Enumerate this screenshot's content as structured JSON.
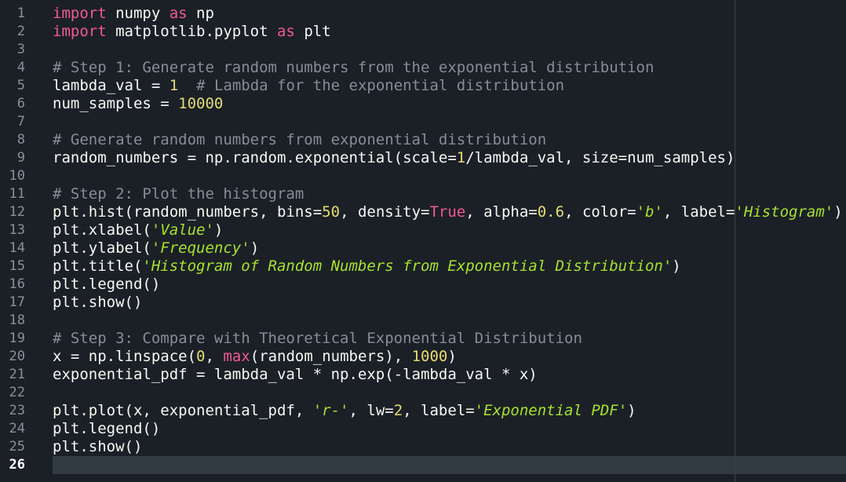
{
  "editor": {
    "active_line": 26,
    "colors": {
      "background": "#1b2027",
      "keyword": "#f25a8f",
      "comment": "#858d96",
      "number": "#e6db74",
      "string": "#a6e22e",
      "text": "#f8f8f2"
    },
    "lines": [
      {
        "n": "1",
        "tokens": [
          {
            "t": "import",
            "c": "kw"
          },
          {
            "t": " numpy "
          },
          {
            "t": "as",
            "c": "kw"
          },
          {
            "t": " np"
          }
        ]
      },
      {
        "n": "2",
        "tokens": [
          {
            "t": "import",
            "c": "kw"
          },
          {
            "t": " matplotlib.pyplot "
          },
          {
            "t": "as",
            "c": "kw"
          },
          {
            "t": " plt"
          }
        ]
      },
      {
        "n": "3",
        "tokens": []
      },
      {
        "n": "4",
        "tokens": [
          {
            "t": "# Step 1: Generate random numbers from the exponential distribution",
            "c": "cm"
          }
        ]
      },
      {
        "n": "5",
        "tokens": [
          {
            "t": "lambda_val = "
          },
          {
            "t": "1",
            "c": "num"
          },
          {
            "t": "  "
          },
          {
            "t": "# Lambda for the exponential distribution",
            "c": "cm"
          }
        ]
      },
      {
        "n": "6",
        "tokens": [
          {
            "t": "num_samples = "
          },
          {
            "t": "10000",
            "c": "num"
          }
        ]
      },
      {
        "n": "7",
        "tokens": []
      },
      {
        "n": "8",
        "tokens": [
          {
            "t": "# Generate random numbers from exponential distribution",
            "c": "cm"
          }
        ]
      },
      {
        "n": "9",
        "tokens": [
          {
            "t": "random_numbers = np.random.exponential(scale="
          },
          {
            "t": "1",
            "c": "num"
          },
          {
            "t": "/lambda_val, size=num_samples)"
          }
        ]
      },
      {
        "n": "10",
        "tokens": []
      },
      {
        "n": "11",
        "tokens": [
          {
            "t": "# Step 2: Plot the histogram",
            "c": "cm"
          }
        ]
      },
      {
        "n": "12",
        "tokens": [
          {
            "t": "plt.hist(random_numbers, bins="
          },
          {
            "t": "50",
            "c": "num"
          },
          {
            "t": ", density="
          },
          {
            "t": "True",
            "c": "kw"
          },
          {
            "t": ", alpha="
          },
          {
            "t": "0.6",
            "c": "num"
          },
          {
            "t": ", color="
          },
          {
            "t": "'b'",
            "c": "str"
          },
          {
            "t": ", label="
          },
          {
            "t": "'Histogram'",
            "c": "str"
          },
          {
            "t": ")"
          }
        ]
      },
      {
        "n": "13",
        "tokens": [
          {
            "t": "plt.xlabel("
          },
          {
            "t": "'Value'",
            "c": "str"
          },
          {
            "t": ")"
          }
        ]
      },
      {
        "n": "14",
        "tokens": [
          {
            "t": "plt.ylabel("
          },
          {
            "t": "'Frequency'",
            "c": "str"
          },
          {
            "t": ")"
          }
        ]
      },
      {
        "n": "15",
        "tokens": [
          {
            "t": "plt.title("
          },
          {
            "t": "'Histogram of Random Numbers from Exponential Distribution'",
            "c": "str"
          },
          {
            "t": ")"
          }
        ]
      },
      {
        "n": "16",
        "tokens": [
          {
            "t": "plt.legend()"
          }
        ]
      },
      {
        "n": "17",
        "tokens": [
          {
            "t": "plt.show()"
          }
        ]
      },
      {
        "n": "18",
        "tokens": []
      },
      {
        "n": "19",
        "tokens": [
          {
            "t": "# Step 3: Compare with Theoretical Exponential Distribution",
            "c": "cm"
          }
        ]
      },
      {
        "n": "20",
        "tokens": [
          {
            "t": "x = np.linspace("
          },
          {
            "t": "0",
            "c": "num"
          },
          {
            "t": ", "
          },
          {
            "t": "max",
            "c": "bi"
          },
          {
            "t": "(random_numbers), "
          },
          {
            "t": "1000",
            "c": "num"
          },
          {
            "t": ")"
          }
        ]
      },
      {
        "n": "21",
        "tokens": [
          {
            "t": "exponential_pdf = lambda_val * np.exp(-lambda_val * x)"
          }
        ]
      },
      {
        "n": "22",
        "tokens": []
      },
      {
        "n": "23",
        "tokens": [
          {
            "t": "plt.plot(x, exponential_pdf, "
          },
          {
            "t": "'r-'",
            "c": "str"
          },
          {
            "t": ", lw="
          },
          {
            "t": "2",
            "c": "num"
          },
          {
            "t": ", label="
          },
          {
            "t": "'Exponential PDF'",
            "c": "str"
          },
          {
            "t": ")"
          }
        ]
      },
      {
        "n": "24",
        "tokens": [
          {
            "t": "plt.legend()"
          }
        ]
      },
      {
        "n": "25",
        "tokens": [
          {
            "t": "plt.show()"
          }
        ]
      },
      {
        "n": "26",
        "tokens": []
      }
    ]
  }
}
